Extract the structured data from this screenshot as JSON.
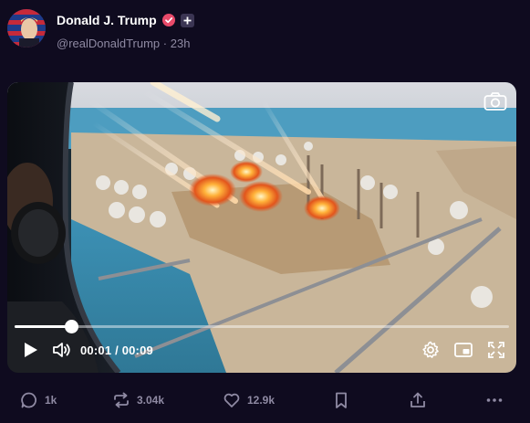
{
  "post": {
    "author_name": "Donald J. Trump",
    "handle": "@realDonaldTrump",
    "separator": "·",
    "time_ago": "23h"
  },
  "video": {
    "current_time": "00:01",
    "time_separator": "/",
    "duration": "00:09",
    "progress_fraction": 0.115
  },
  "actions": {
    "replies": "1k",
    "retruths": "3.04k",
    "likes": "12.9k"
  },
  "icons": {
    "verified": "verified-badge-icon",
    "plus": "plus-badge-icon",
    "camera": "camera-icon",
    "play": "play-icon",
    "volume": "volume-icon",
    "settings": "gear-icon",
    "pip": "picture-in-picture-icon",
    "fullscreen": "fullscreen-icon",
    "reply": "reply-icon",
    "retruth": "retruth-icon",
    "like": "heart-icon",
    "bookmark": "bookmark-icon",
    "share": "share-icon",
    "more": "more-icon"
  },
  "colors": {
    "background": "#0f0b1f",
    "muted_text": "#8f8aa3",
    "verified": "#e84a6a"
  }
}
